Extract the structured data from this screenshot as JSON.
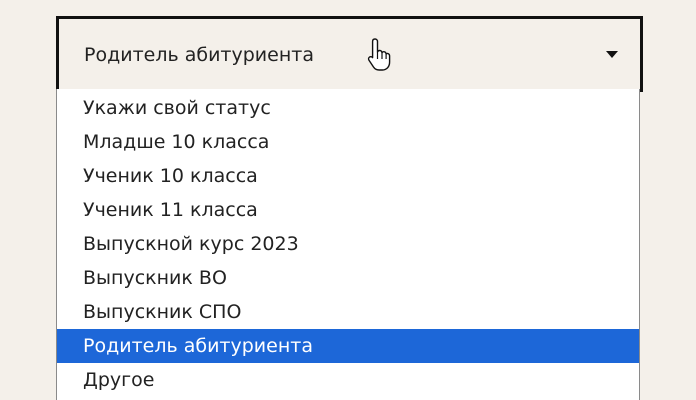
{
  "select": {
    "value": "Родитель абитуриента",
    "options": [
      "Укажи свой статус",
      "Младше 10 класса",
      "Ученик 10 класса",
      "Ученик 11 класса",
      "Выпускной курс 2023",
      "Выпускник ВО",
      "Выпускник СПО",
      "Родитель абитуриента",
      "Другое"
    ],
    "selected_index": 7
  },
  "colors": {
    "page_background": "#f4f0ea",
    "highlight": "#1d67d8"
  },
  "icons": {
    "caret": "caret-down-icon",
    "cursor": "hand-pointer-icon"
  }
}
